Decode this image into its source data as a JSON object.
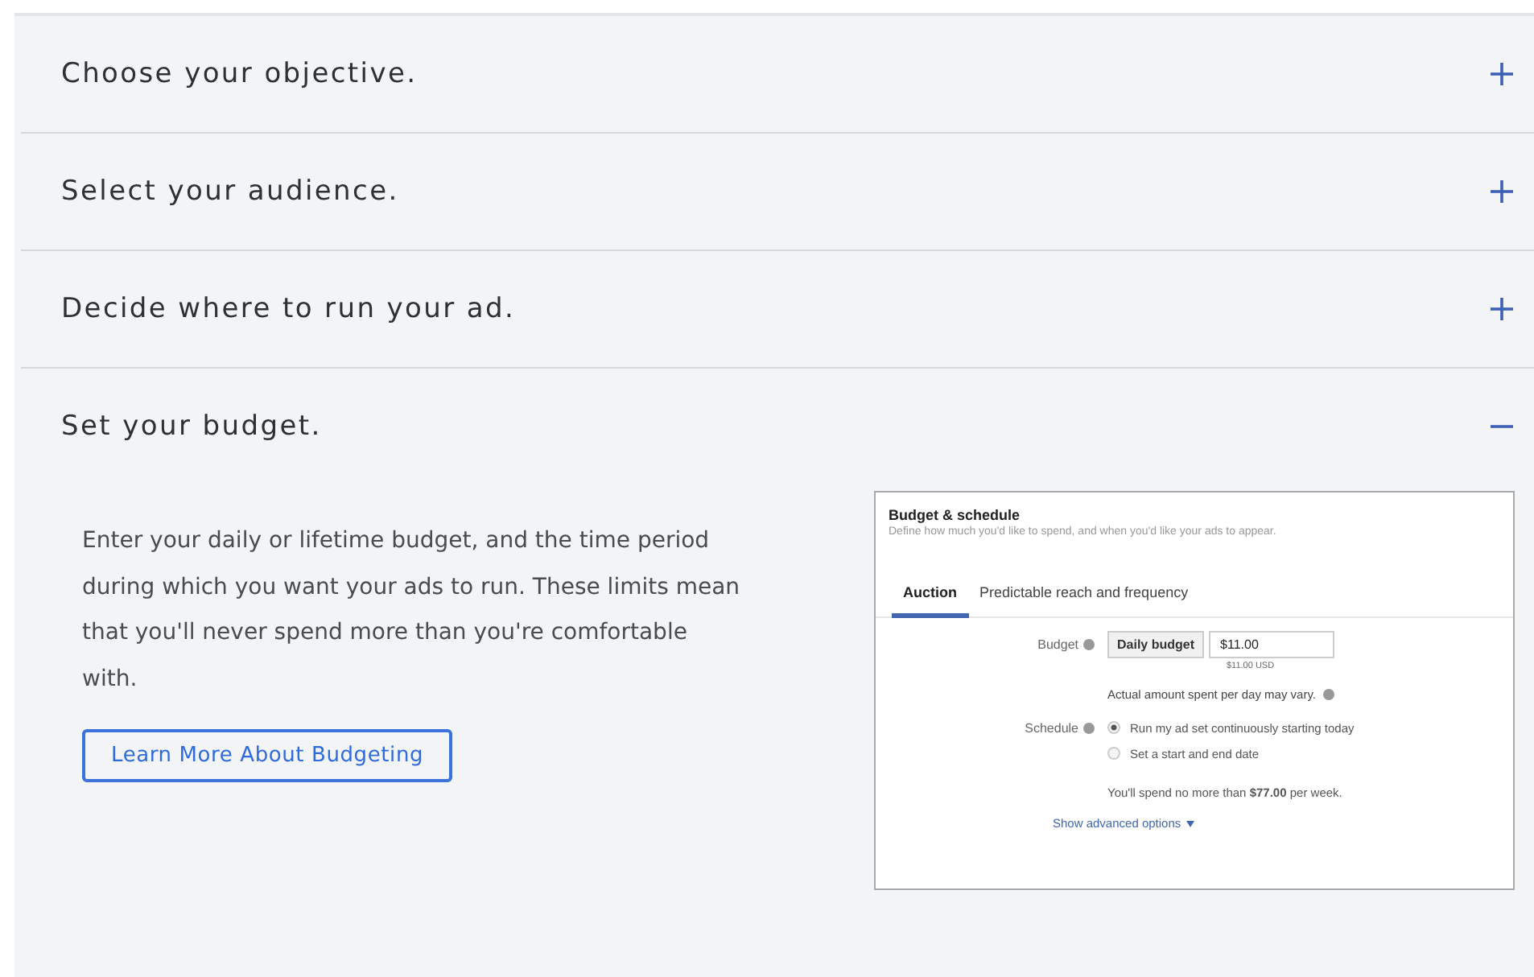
{
  "sections": [
    {
      "title": "Choose your objective.",
      "expanded": false
    },
    {
      "title": "Select your audience.",
      "expanded": false
    },
    {
      "title": "Decide where to run your ad.",
      "expanded": false
    },
    {
      "title": "Set your budget.",
      "expanded": true,
      "description": "Enter your daily or lifetime budget, and the time period during which you want your ads to run. These limits mean that you'll never spend more than you're comfortable with.",
      "button": "Learn More About Budgeting",
      "preview": {
        "title": "Budget & schedule",
        "subtitle": "Define how much you'd like to spend, and when you'd like your ads to appear.",
        "tabs": [
          {
            "label": "Auction",
            "selected": true
          },
          {
            "label": "Predictable reach and frequency",
            "selected": false
          }
        ],
        "budget_label": "Budget",
        "budget_type": "Daily budget",
        "budget_value": "$11.00",
        "budget_note": "$11.00 USD",
        "variance_note": "Actual amount spent per day may vary.",
        "schedule_label": "Schedule",
        "schedule_options": [
          {
            "label": "Run my ad set continuously starting today",
            "selected": true
          },
          {
            "label": "Set a start and end date",
            "selected": false
          }
        ],
        "weekly_note": "You'll spend no more than **$77.00** per week.",
        "advanced_link": "Show advanced options"
      }
    }
  ]
}
